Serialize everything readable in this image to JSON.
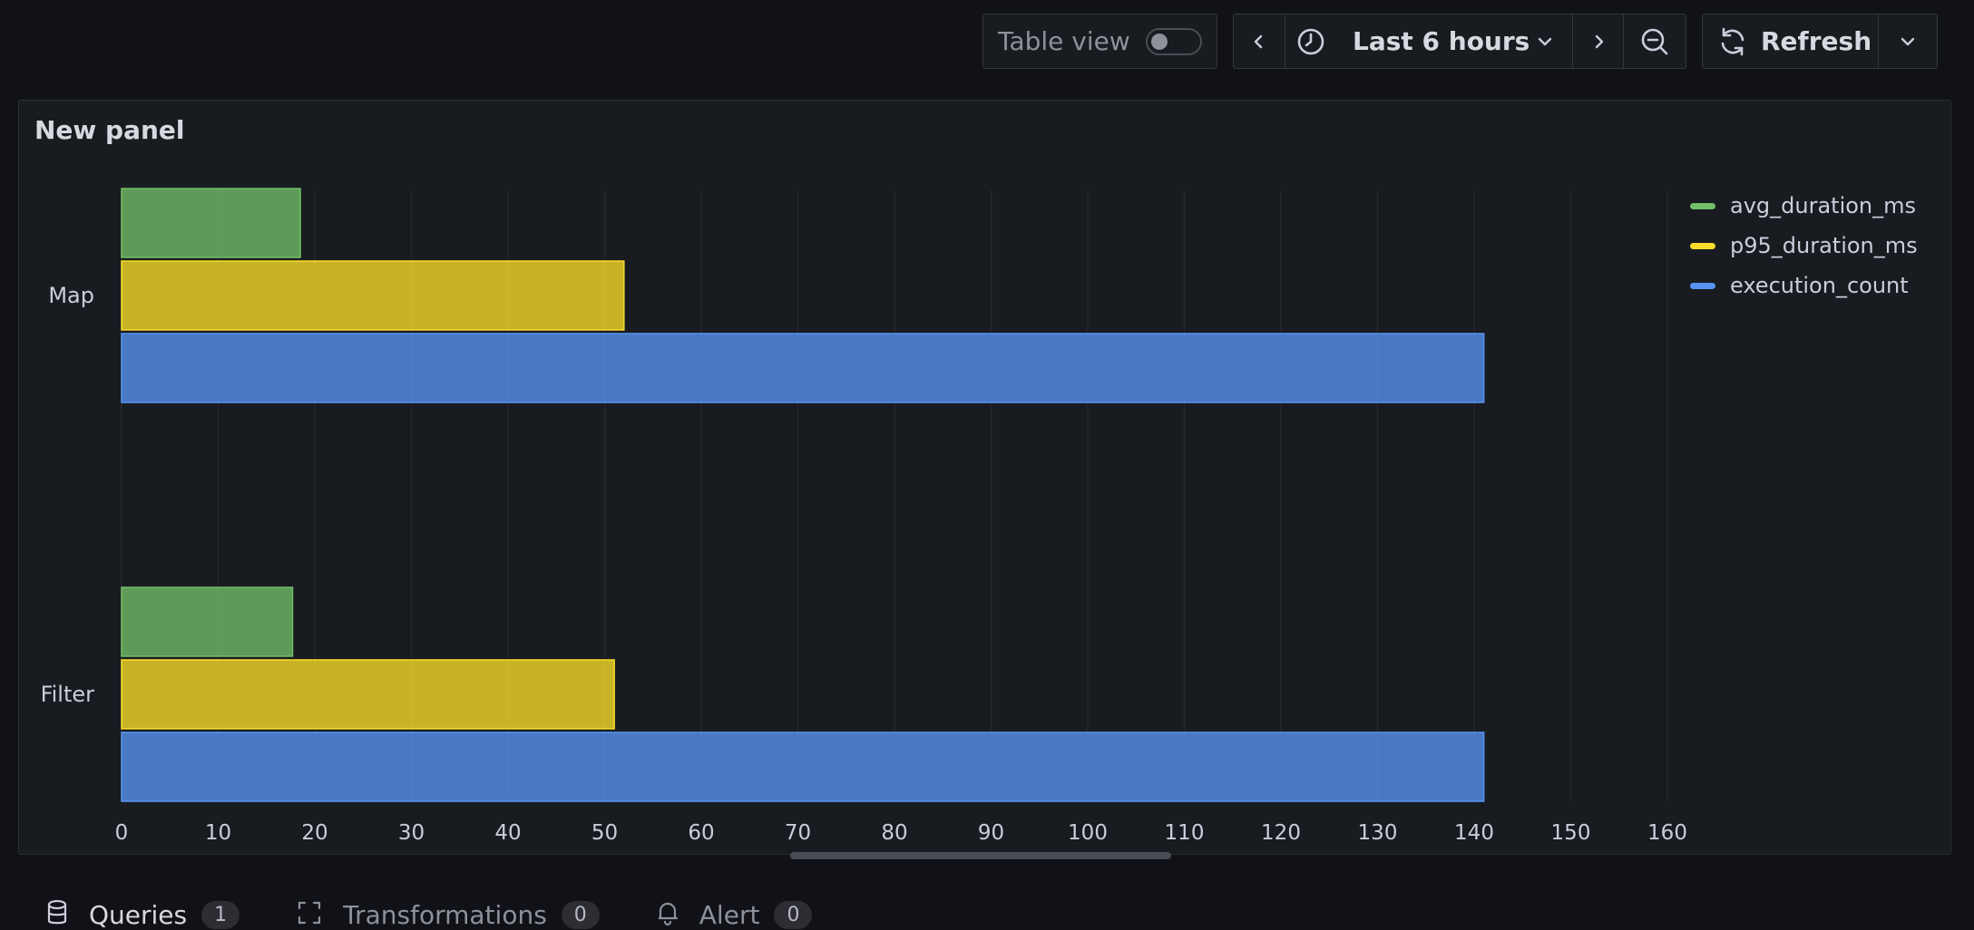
{
  "toolbar": {
    "table_view_label": "Table view",
    "table_view_on": false,
    "time_range_label": "Last 6 hours",
    "refresh_label": "Refresh",
    "icons": {
      "prev": "chevron-left-icon",
      "clock": "clock-icon",
      "range_dropdown": "chevron-down-icon",
      "next": "chevron-right-icon",
      "zoom_out": "zoom-out-icon",
      "refresh": "refresh-icon",
      "refresh_dropdown": "chevron-down-icon"
    }
  },
  "panel": {
    "title": "New panel"
  },
  "chart_data": {
    "type": "bar",
    "orientation": "horizontal",
    "title": "",
    "xlabel": "",
    "ylabel": "",
    "categories": [
      "Map",
      "Filter"
    ],
    "series": [
      {
        "name": "avg_duration_ms",
        "color": "#73bf69",
        "values": [
          18.5,
          17.7
        ]
      },
      {
        "name": "p95_duration_ms",
        "color": "#fade2a",
        "values": [
          52,
          51
        ]
      },
      {
        "name": "execution_count",
        "color": "#5794f2",
        "values": [
          141,
          141
        ]
      }
    ],
    "xlim": [
      0,
      160
    ],
    "xticks": [
      0,
      10,
      20,
      30,
      40,
      50,
      60,
      70,
      80,
      90,
      100,
      110,
      120,
      130,
      140,
      150,
      "160"
    ],
    "grid": true,
    "legend": "right"
  },
  "bottom_tabs": [
    {
      "label": "Queries",
      "count": "1",
      "icon": "database-icon",
      "active": true
    },
    {
      "label": "Transformations",
      "count": "0",
      "icon": "transform-icon",
      "active": false
    },
    {
      "label": "Alert",
      "count": "0",
      "icon": "bell-icon",
      "active": false
    }
  ],
  "colors": {
    "background": "#111217",
    "panel": "#181b1f",
    "border": "#2c2e33",
    "text": "#ccccdc"
  }
}
